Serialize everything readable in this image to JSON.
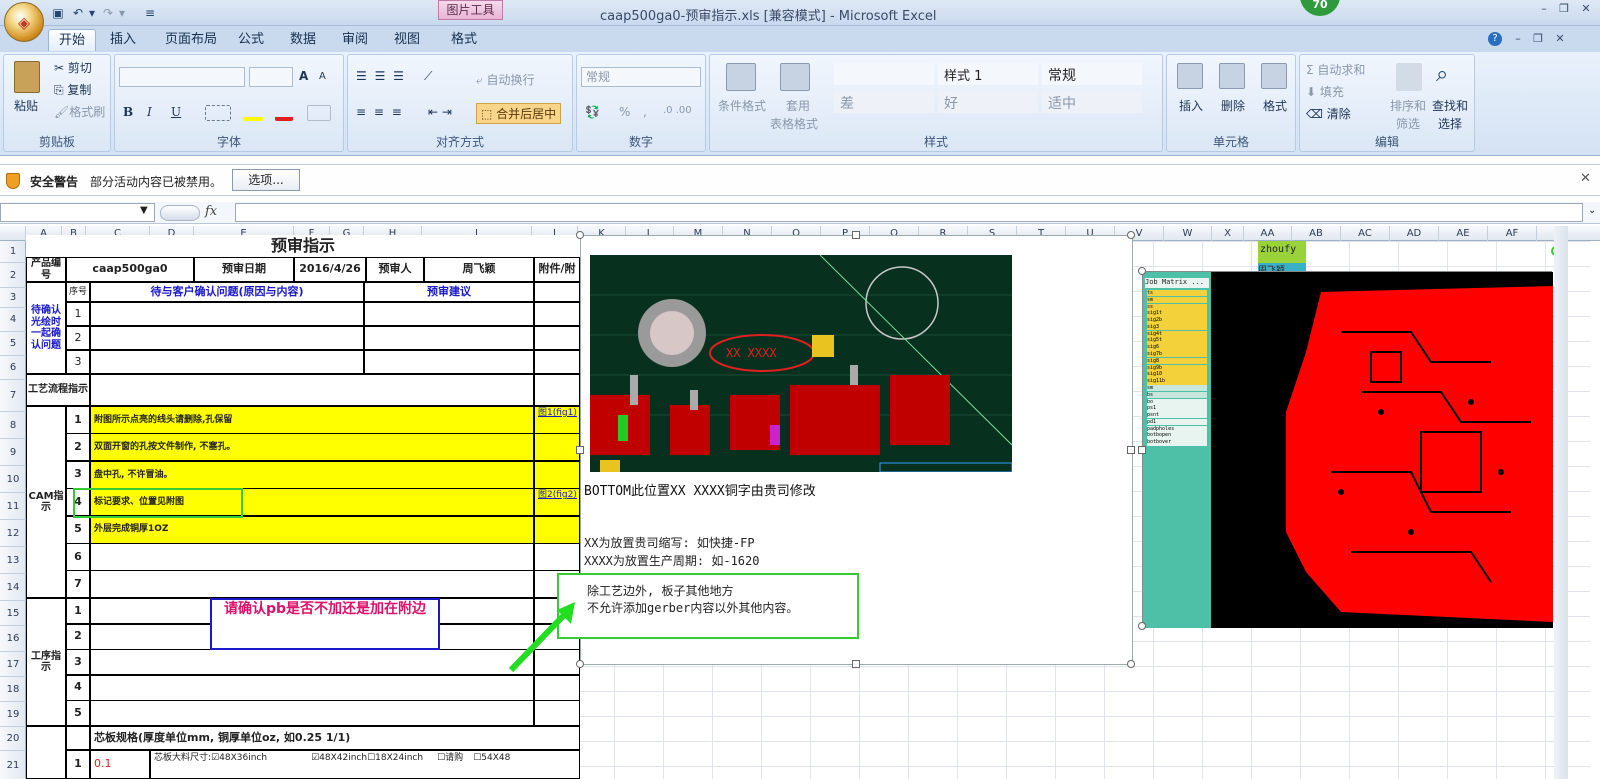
{
  "window": {
    "title": "caap500ga0-预审指示.xls  [兼容模式] - Microsoft Excel",
    "picture_tools": "图片工具",
    "badge": "70"
  },
  "tabs": [
    "开始",
    "插入",
    "页面布局",
    "公式",
    "数据",
    "审阅",
    "视图",
    "格式"
  ],
  "ribbon": {
    "clipboard": {
      "paste": "粘贴",
      "cut": "剪切",
      "copy": "复制",
      "format_painter": "格式刷",
      "label": "剪贴板"
    },
    "font": {
      "label": "字体",
      "bold": "B",
      "italic": "I",
      "underline": "U",
      "grow": "A",
      "shrink": "A"
    },
    "alignment": {
      "wrap": "自动换行",
      "merge": "合并后居中",
      "label": "对齐方式"
    },
    "number": {
      "format": "常规",
      "percent": "%",
      "comma": ",",
      "label": "数字"
    },
    "styles": {
      "conditional": "条件格式",
      "table": "套用",
      "table2": "表格格式",
      "s1": "",
      "s2": "样式 1",
      "s3": "常规",
      "s4": "差",
      "s5": "好",
      "s6": "适中",
      "label": "样式"
    },
    "cells": {
      "insert": "插入",
      "delete": "删除",
      "format": "格式",
      "label": "单元格"
    },
    "editing": {
      "autosum": "Σ 自动求和",
      "fill": "填充",
      "clear": "清除",
      "sort": "排序和",
      "sort2": "筛选",
      "find": "查找和",
      "find2": "选择",
      "label": "编辑"
    }
  },
  "security": {
    "title": "安全警告",
    "message": "部分活动内容已被禁用。",
    "options": "选项..."
  },
  "formula": {
    "fx": "fx",
    "value": ""
  },
  "columns": [
    "A",
    "B",
    "C",
    "D",
    "E",
    "F",
    "G",
    "H",
    "I",
    "J",
    "K",
    "L",
    "M",
    "N",
    "O",
    "P",
    "Q",
    "R",
    "S",
    "T",
    "U",
    "V",
    "W",
    "X",
    "AA",
    "AB",
    "AC",
    "AD",
    "AE",
    "AF"
  ],
  "rows": [
    "1",
    "2",
    "3",
    "4",
    "5",
    "6",
    "7",
    "8",
    "9",
    "10",
    "11",
    "12",
    "13",
    "14",
    "15",
    "16",
    "17",
    "18",
    "19",
    "20",
    "21"
  ],
  "sheet": {
    "title": "预审指示",
    "product_label": "产品编号",
    "product": "caap500ga0",
    "review_date_label": "预审日期",
    "review_date": "2016/4/26",
    "reviewer_label": "预审人",
    "reviewer": "周飞颖",
    "attach_label": "附件/附",
    "seq": "序号",
    "pending_header": "待与客户确认问题(原因与内容)",
    "suggest_header": "预审建议",
    "pending_label": "待确认光绘时一起确认问题",
    "process_label": "工艺流程指示",
    "cam_label": "CAM指示",
    "cam_items": [
      {
        "n": "1",
        "text": "附图所示点亮的线头请删除,孔保留",
        "att": "图1(fig1)"
      },
      {
        "n": "2",
        "text": "双面开窗的孔按文件制作, 不塞孔。",
        "att": ""
      },
      {
        "n": "3",
        "text": "盘中孔, 不许冒油。",
        "att": ""
      },
      {
        "n": "4",
        "text": "标记要求、位置见附图",
        "att": "图2(fig2)"
      },
      {
        "n": "5",
        "text": "外层完成铜厚1OZ",
        "att": ""
      },
      {
        "n": "6",
        "text": "",
        "att": ""
      },
      {
        "n": "7",
        "text": "",
        "att": ""
      }
    ],
    "proc_label": "工序指示",
    "proc_items": [
      "1",
      "2",
      "3",
      "4",
      "5"
    ],
    "core_spec": "芯板规格(厚度单位mm, 铜厚单位oz, 如0.25 1/1)",
    "core_row": {
      "n": "1",
      "val": "0.1",
      "size_label": "芯板大料尺寸:",
      "o1": "48X36inch",
      "o2": "48X42inch",
      "o3": "18X24inch",
      "o4": "请购",
      "o5": "54X48"
    },
    "pending_nums": [
      "1",
      "2",
      "3"
    ],
    "proc_nums": [
      "1",
      "2",
      "3",
      "4",
      "5"
    ]
  },
  "annotation": {
    "question": "请确认pb是否不加还是加在附边"
  },
  "picture1": {
    "caption": "BOTTOM此位置XX XXXX铜字由贵司修改",
    "line1": "XX为放置贵司缩写: 如快捷-FP",
    "line2": "XXXX为放置生产周期: 如-1620",
    "note1": "除工艺边外, 板子其他地方",
    "note2": "不允许添加gerber内容以外其他内容。",
    "pcb_label": "XX XXXX"
  },
  "side": {
    "name": "zhoufy",
    "name2": "周飞颖",
    "panel_title": "Job Matrix ...",
    "layers": [
      "ts",
      "sm",
      "ss",
      "sig1t",
      "sig2b",
      "sig3",
      "sig4t",
      "sig5t",
      "sig6",
      "sig7b",
      "sig8",
      "sig9b",
      "sig10",
      "sig11b",
      "sm",
      "bs",
      "bo",
      "ps1",
      "psnt",
      "pd1",
      "padpholes",
      "botbopen",
      "botbover"
    ]
  },
  "colors": {
    "accent": "#c9d9ee",
    "yellow": "#ffff00",
    "green_annot": "#33cc33",
    "pcb_red": "#ff0000"
  }
}
